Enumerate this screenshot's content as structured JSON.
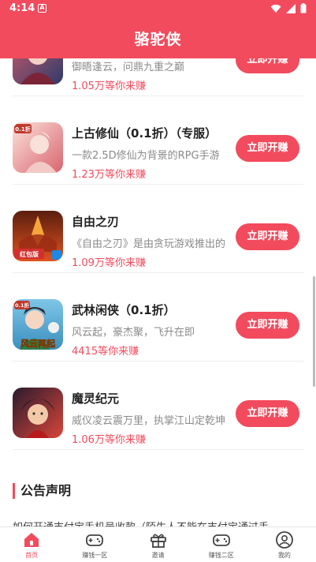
{
  "status_bar": {
    "time": "4:14",
    "badge": "A"
  },
  "header": {
    "title": "骆驼侠"
  },
  "games": [
    {
      "name": "",
      "desc": "御晤逢云，问鼎九重之巅",
      "earn": "1.05万等你来赚",
      "button": "立即开赚",
      "icon_colors": [
        "#c95a6a",
        "#2d3b6b"
      ]
    },
    {
      "name": "上古修仙（0.1折）（专服）",
      "desc": "一款2.5D修仙为背景的RPG手游",
      "earn": "1.23万等你来赚",
      "button": "立即开赚",
      "icon_colors": [
        "#f3b7b0",
        "#d9646e"
      ],
      "badge": "0.1折"
    },
    {
      "name": "自由之刃",
      "desc": "《自由之刃》是由贪玩游戏推出的",
      "earn": "1.09万等你来赚",
      "button": "立即开赚",
      "icon_colors": [
        "#5a1e0e",
        "#e0531f"
      ],
      "badge": "红包版"
    },
    {
      "name": "武林闲侠（0.1折）",
      "desc": "风云起，豪杰聚，飞升在即",
      "earn": "4415等你来赚",
      "button": "立即开赚",
      "icon_colors": [
        "#3b8fbf",
        "#e9c25a"
      ],
      "badge": "0.1折",
      "caption": "风云再起"
    },
    {
      "name": "魔灵纪元",
      "desc": "威仪凌云震万里，执掌江山定乾坤",
      "earn": "1.06万等你来赚",
      "button": "立即开赚",
      "icon_colors": [
        "#2a1b2e",
        "#d8453a"
      ]
    }
  ],
  "notice": {
    "title": "公告声明",
    "text": "如何开通支付宝手机号收款（陌生人不能在支付宝通过手"
  },
  "bottom_nav": [
    {
      "label": "首页",
      "icon": "home-icon",
      "active": true
    },
    {
      "label": "赚钱一区",
      "icon": "gamepad-icon",
      "active": false
    },
    {
      "label": "邀请",
      "icon": "gift-icon",
      "active": false
    },
    {
      "label": "赚钱二区",
      "icon": "gamepad-icon",
      "active": false
    },
    {
      "label": "我的",
      "icon": "user-icon",
      "active": false
    }
  ],
  "colors": {
    "brand": "#f24b5d",
    "muted": "#8a8a8a"
  }
}
